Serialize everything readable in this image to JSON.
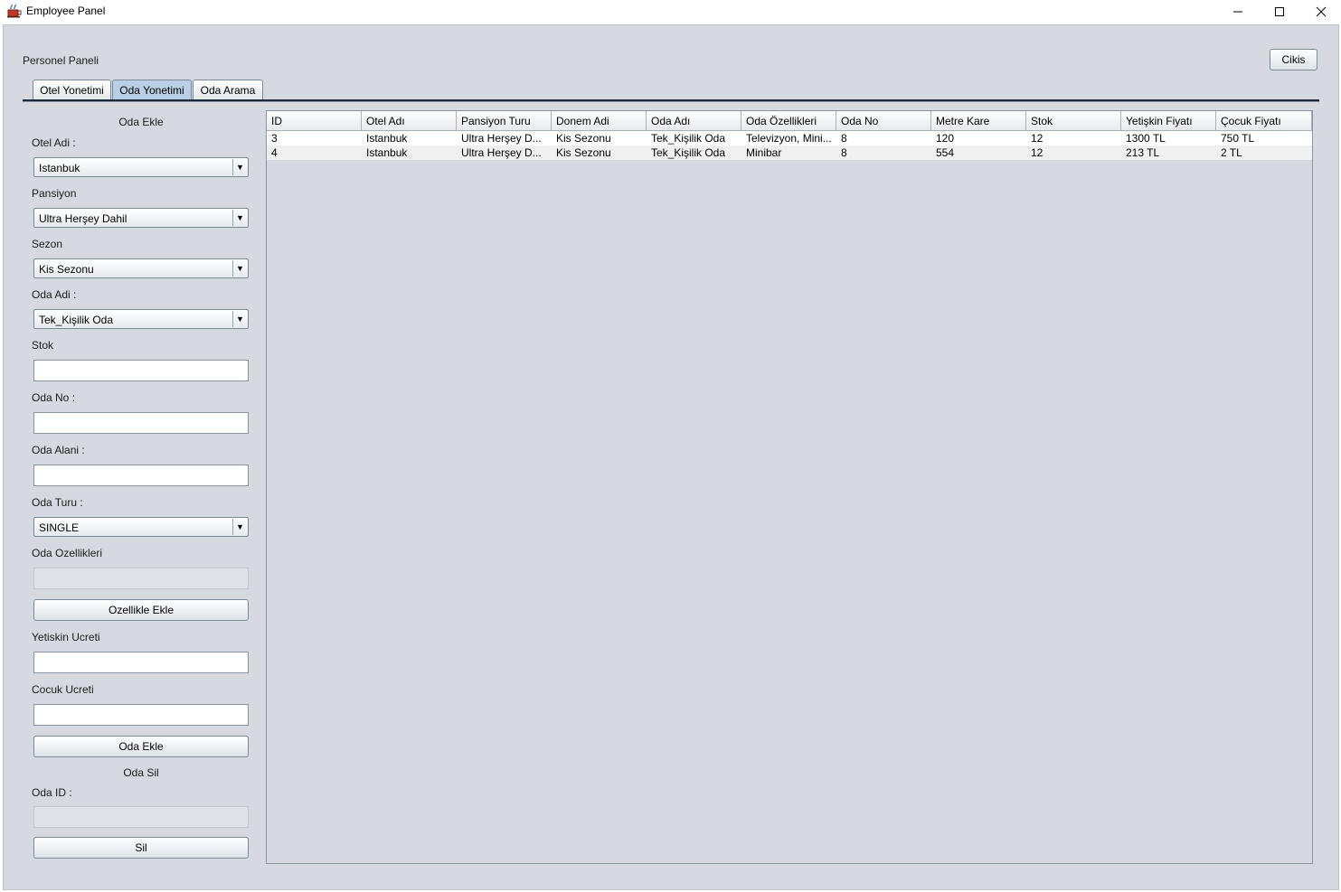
{
  "window": {
    "title": "Employee Panel",
    "icon": "java-cup-icon"
  },
  "header": {
    "panel_title": "Personel Paneli",
    "exit_label": "Cikis"
  },
  "tabs": [
    {
      "label": "Otel Yonetimi",
      "active": false
    },
    {
      "label": "Oda Yonetimi",
      "active": true
    },
    {
      "label": "Oda Arama",
      "active": false
    }
  ],
  "form": {
    "section_title": "Oda Ekle",
    "hotel_label": "Otel Adi :",
    "hotel_value": "Istanbuk",
    "pension_label": "Pansiyon",
    "pension_value": "Ultra Herşey Dahil",
    "season_label": "Sezon",
    "season_value": "Kis Sezonu",
    "room_name_label": "Oda Adi :",
    "room_name_value": "Tek_Kişilik Oda",
    "stock_label": "Stok",
    "stock_value": "",
    "room_no_label": "Oda No :",
    "room_no_value": "",
    "room_area_label": "Oda Alani :",
    "room_area_value": "",
    "room_type_label": "Oda Turu :",
    "room_type_value": "SINGLE",
    "features_label": "Oda Ozellikleri",
    "features_value": "",
    "add_feature_label": "Ozellikle  Ekle",
    "adult_price_label": "Yetiskin Ucreti",
    "adult_price_value": "",
    "child_price_label": "Cocuk Ucreti",
    "child_price_value": "",
    "add_room_label": "Oda Ekle"
  },
  "delete": {
    "section_title": "Oda Sil",
    "room_id_label": "Oda ID :",
    "room_id_value": "",
    "delete_label": "Sil"
  },
  "table": {
    "columns": [
      "ID",
      "Otel Adı",
      "Pansiyon Turu",
      "Donem Adi",
      "Oda Adı",
      "Oda Özellikleri",
      "Oda No",
      "Metre Kare",
      "Stok",
      "Yetişkin Fiyatı",
      "Çocuk Fiyatı"
    ],
    "rows": [
      [
        "3",
        "Istanbuk",
        "Ultra Herşey D...",
        "Kis Sezonu",
        "Tek_Kişilik Oda",
        "Televizyon, Mini...",
        "8",
        "120",
        "12",
        "1300 TL",
        "750 TL"
      ],
      [
        "4",
        "Istanbuk",
        "Ultra Herşey D...",
        "Kis Sezonu",
        "Tek_Kişilik Oda",
        "Minibar",
        "8",
        "554",
        "12",
        "213 TL",
        "2 TL"
      ]
    ]
  }
}
